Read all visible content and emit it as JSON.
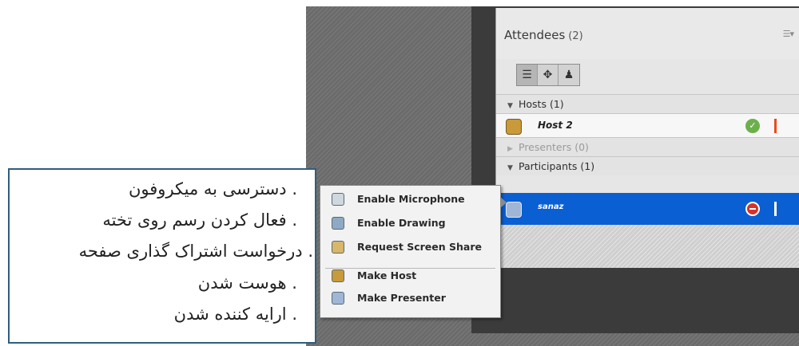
{
  "attendees_pod": {
    "title": "Attendees",
    "count": "(2)",
    "menu_icon": "pod-menu-icon",
    "view_buttons": [
      {
        "icon": "list-view-icon",
        "active": true
      },
      {
        "icon": "grid-view-icon",
        "active": false
      },
      {
        "icon": "status-view-icon",
        "active": false
      }
    ],
    "sections": {
      "hosts": {
        "label": "Hosts (1)"
      },
      "presenters": {
        "label": "Presenters (0)"
      },
      "participants": {
        "label": "Participants (1)"
      }
    },
    "attendees": [
      {
        "name": "Host 2",
        "status_icon": "status-ok-icon",
        "status_color": "#6cb04c",
        "bar_color": "#e84a1c",
        "selected": false
      },
      {
        "name": "sanaz",
        "status_icon": "status-blocked-icon",
        "status_color": "#d9302b",
        "bar_color": "#ffffff",
        "selected": true
      }
    ]
  },
  "context_menu": {
    "items": [
      {
        "label": "Enable Microphone",
        "icon": "microphone-icon"
      },
      {
        "label": "Enable Drawing",
        "icon": "drawing-icon"
      },
      {
        "label": "Request Screen Share",
        "icon": "screen-share-icon"
      },
      {
        "label": "Make Host",
        "icon": "host-icon"
      },
      {
        "label": "Make Presenter",
        "icon": "presenter-icon"
      }
    ]
  },
  "callout": {
    "lines": [
      ". دسترسی به میکروفون",
      ". فعال کردن رسم روی تخته",
      ". درخواست اشتراک گذاری صفحه",
      ". هوست شدن",
      ". ارایه کننده شدن"
    ]
  },
  "colors": {
    "selection_blue": "#0a5fd3",
    "frame_dark": "#3b3b3b",
    "callout_border": "#2f5e7d"
  }
}
